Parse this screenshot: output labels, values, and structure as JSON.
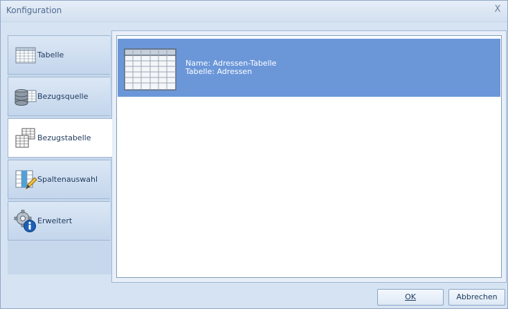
{
  "window": {
    "title": "Konfiguration",
    "close_label": "X"
  },
  "nav": {
    "items": [
      {
        "label": "Tabelle",
        "icon": "table-grid-icon",
        "active": false
      },
      {
        "label": "Bezugsquelle",
        "icon": "database-icon",
        "active": false
      },
      {
        "label": "Bezugstabelle",
        "icon": "related-tables-icon",
        "active": true
      },
      {
        "label": "Spaltenauswahl",
        "icon": "column-select-pencil-icon",
        "active": false
      },
      {
        "label": "Erweitert",
        "icon": "gear-info-icon",
        "active": false
      }
    ]
  },
  "list": {
    "items": [
      {
        "name": "Name: Adressen-Tabelle",
        "table": "Tabelle: Adressen",
        "icon": "table-grid-icon",
        "selected": true
      }
    ]
  },
  "buttons": {
    "ok": "OK",
    "cancel": "Abbrechen"
  },
  "colors": {
    "selection": "#6b97d9",
    "panel": "#d6e3f2"
  }
}
